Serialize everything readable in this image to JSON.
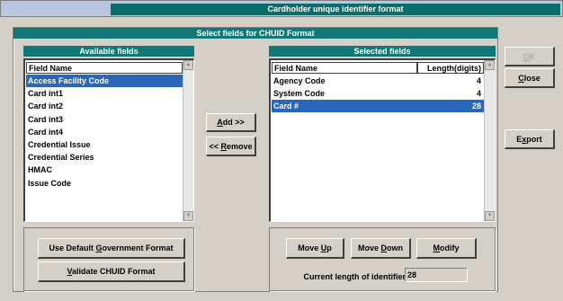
{
  "window": {
    "title": "Cardholder unique identifier format"
  },
  "group": {
    "title": "Select fields for CHUID Format"
  },
  "available": {
    "title": "Available fields",
    "column_header": "Field Name",
    "items": [
      "Access Facility Code",
      "Card int1",
      "Card int2",
      "Card int3",
      "Card int4",
      "Credential Issue",
      "Credential Series",
      "HMAC",
      "Issue Code"
    ],
    "selected_index": 0
  },
  "selected": {
    "title": "Selected fields",
    "column_headers": [
      "Field Name",
      "Length(digits)"
    ],
    "rows": [
      {
        "name": "Agency Code",
        "length": "4"
      },
      {
        "name": "System Code",
        "length": "4"
      },
      {
        "name": "Card #",
        "length": "28"
      }
    ],
    "selected_index": 2
  },
  "buttons": {
    "add": {
      "pre": "",
      "key": "A",
      "post": "dd >>"
    },
    "remove": {
      "pre": "<< ",
      "key": "R",
      "post": "emove"
    },
    "default_format": {
      "pre": "Use Default ",
      "key": "G",
      "post": "overnment Format"
    },
    "validate": {
      "pre": "",
      "key": "V",
      "post": "alidate CHUID Format"
    },
    "move_up": {
      "pre": "Move ",
      "key": "U",
      "post": "p"
    },
    "move_down": {
      "pre": "Move ",
      "key": "D",
      "post": "own"
    },
    "modify": {
      "pre": "",
      "key": "M",
      "post": "odify"
    },
    "ok": {
      "pre": "",
      "key": "O",
      "post": "K"
    },
    "close": {
      "pre": "",
      "key": "C",
      "post": "lose"
    },
    "export": {
      "pre": "E",
      "key": "x",
      "post": "port"
    }
  },
  "current_length": {
    "label": "Current length of identifier:",
    "value": "28"
  },
  "colors": {
    "title_bar": "#0b6c6c",
    "section_bar": "#117777",
    "selection": "#2a67b8"
  }
}
